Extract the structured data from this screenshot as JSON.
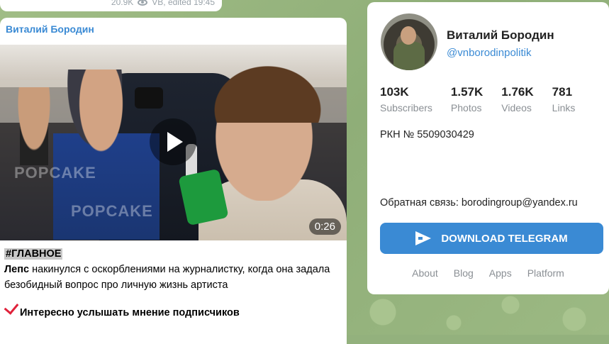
{
  "prev_post": {
    "views": "20.9K",
    "meta": "VB, edited  19:45"
  },
  "post": {
    "author": "Виталий Бородин",
    "duration": "0:26",
    "watermark": "POPCAKE",
    "hashtag": "#ГЛАВНОЕ",
    "text_bold": "Лепс",
    "text_rest": " накинулся с оскорблениями на журналистку, когда она задала безобидный вопрос про личную жизнь артиста",
    "cta": "Интересно услышать мнение подписчиков"
  },
  "channel": {
    "name": "Виталий Бородин",
    "username": "@vnborodinpolitik",
    "stats": [
      {
        "value": "103K",
        "label": "Subscribers"
      },
      {
        "value": "1.57K",
        "label": "Photos"
      },
      {
        "value": "1.76K",
        "label": "Videos"
      },
      {
        "value": "781",
        "label": "Links"
      }
    ],
    "rkn": "РКН № 5509030429",
    "feedback": "Обратная связь: borodingroup@yandex.ru",
    "download_label": "DOWNLOAD TELEGRAM",
    "links": [
      "About",
      "Blog",
      "Apps",
      "Platform"
    ]
  },
  "colors": {
    "accent": "#3a8ad4",
    "background": "#93b17d",
    "check": "#e0213a"
  },
  "icons": {
    "views": "eye-icon",
    "play": "play-icon",
    "download": "telegram-plane-icon",
    "check": "check-icon"
  }
}
